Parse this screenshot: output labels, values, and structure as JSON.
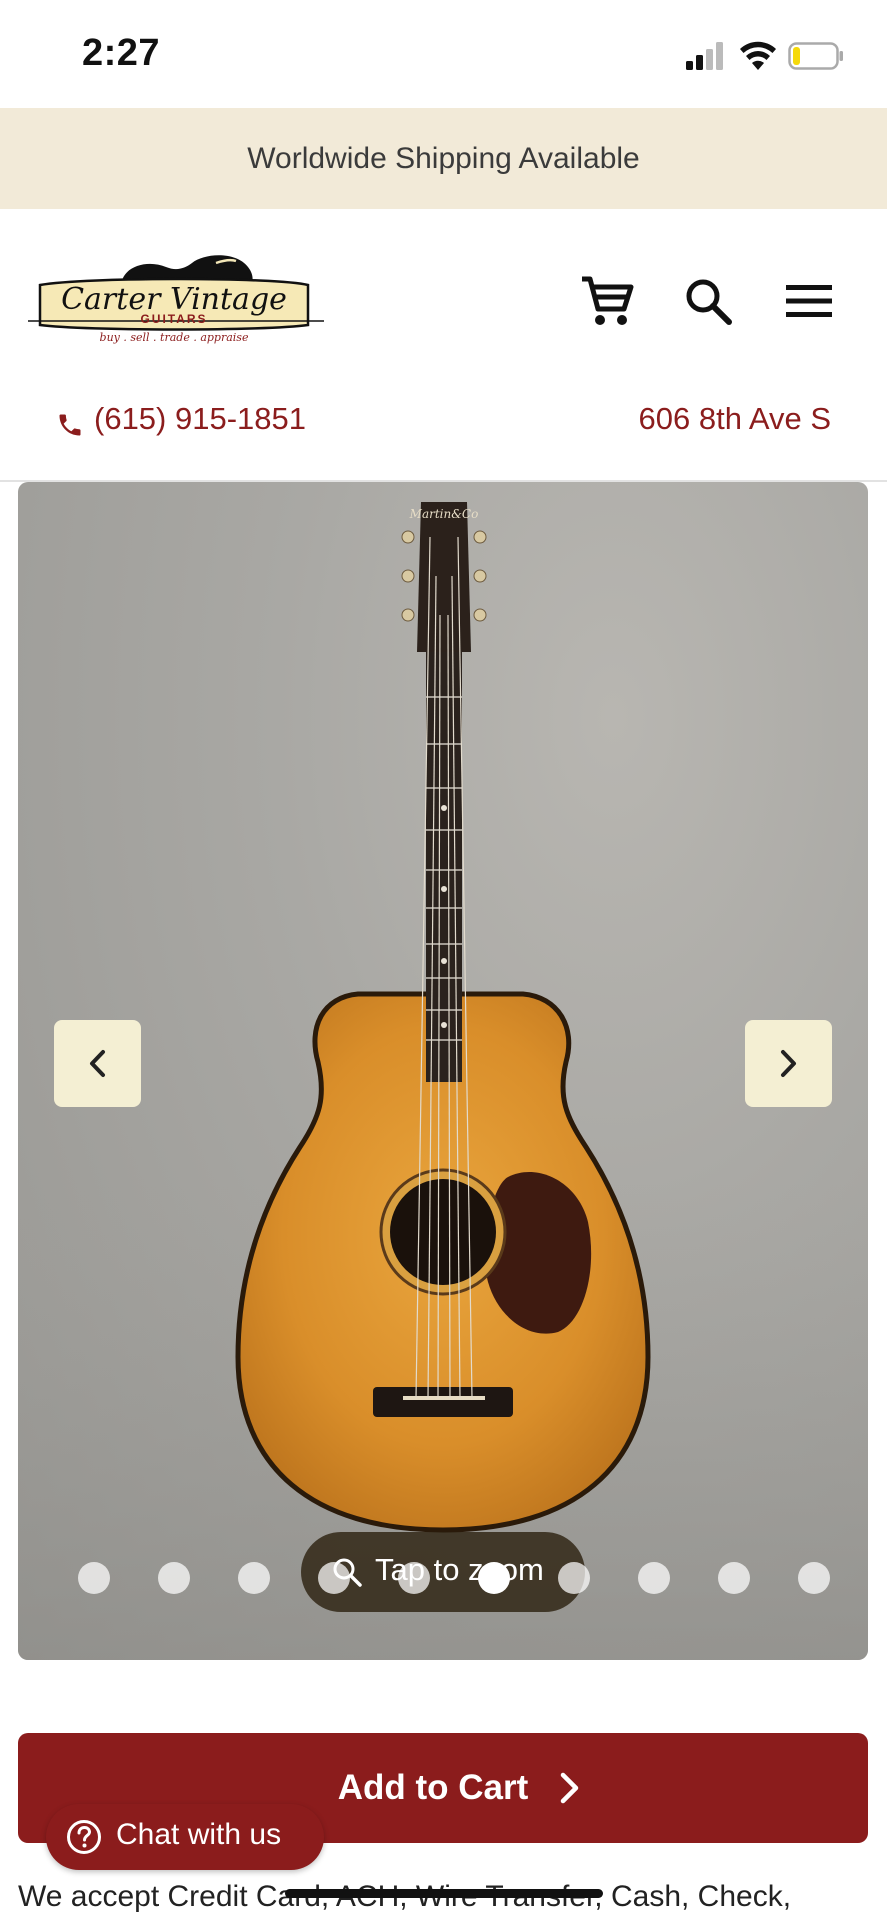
{
  "status_bar": {
    "time": "2:27",
    "signal_icon": "signal-icon",
    "wifi_icon": "wifi-icon",
    "battery_icon": "battery-icon"
  },
  "banner": {
    "text": "Worldwide Shipping Available"
  },
  "header": {
    "logo": {
      "name": "Carter Vintage",
      "sub": "GUITARS",
      "tagline": "buy . sell . trade . appraise"
    },
    "icons": [
      "cart-icon",
      "search-icon",
      "menu-icon"
    ]
  },
  "contact": {
    "phone": "(615) 915-1851",
    "address": "606 8th Ave S"
  },
  "gallery": {
    "zoom_label": "Tap to zoom",
    "dot_count": 10,
    "active_dot": 6,
    "headstock_brand": "Martin&Co"
  },
  "cart": {
    "label": "Add to Cart"
  },
  "chat": {
    "label": "Chat with us"
  },
  "payment": {
    "text": "We accept Credit Card, ACH, Wire Transfer, Cash, Check,"
  },
  "colors": {
    "brand_red": "#8b1c1c",
    "banner_bg": "#f2ead8",
    "nav_button_bg": "#f4efd3"
  }
}
